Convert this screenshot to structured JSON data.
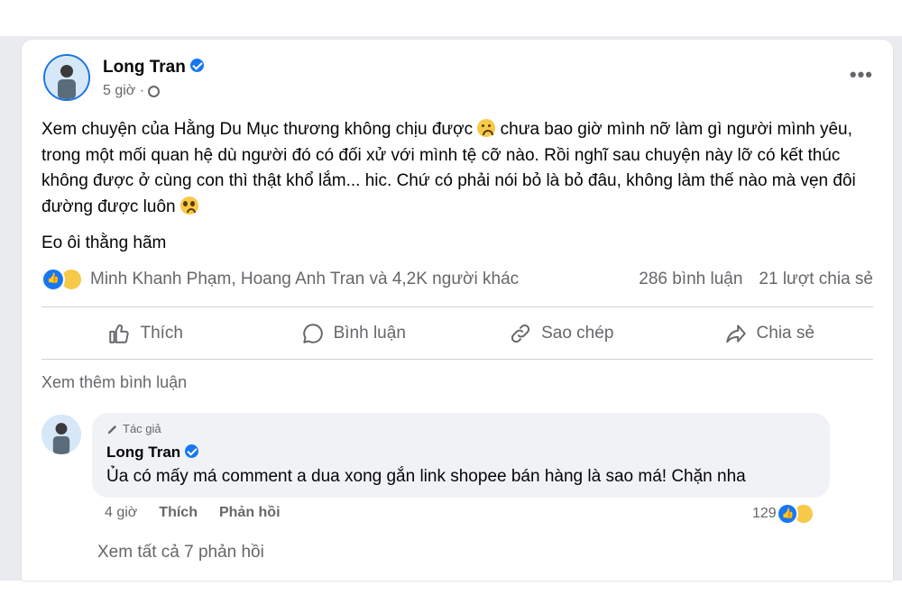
{
  "post": {
    "author": "Long Tran",
    "time": "5 giờ ·",
    "menu_label": "•••",
    "text_line1": "Xem chuyện của Hằng Du Mục thương không chịu được",
    "text_line1b": "chưa bao giờ mình nỡ làm gì người mình yêu, trong một mối quan hệ dù người đó có đối xử với mình tệ cỡ nào. Rồi nghĩ sau chuyện này lỡ có kết thúc không được ở cùng con thì thật khổ lắm... hic. Chứ có phải nói bỏ là bỏ đâu, không làm thế nào mà vẹn đôi đường được luôn",
    "text_para2": "Eo ôi thằng hãm",
    "reactions_summary": "Minh Khanh Phạm, Hoang Anh Tran và 4,2K người khác",
    "comments_count": "286 bình luận",
    "shares_count": "21 lượt chia sẻ"
  },
  "actions": {
    "like": "Thích",
    "comment": "Bình luận",
    "copy": "Sao chép",
    "share": "Chia sẻ"
  },
  "comments": {
    "see_more": "Xem thêm bình luận",
    "item": {
      "badge": "Tác giả",
      "author": "Long Tran",
      "text": "Ủa có mấy má comment a dua xong gắn link shopee bán hàng là sao má! Chặn nha",
      "time": "4 giờ",
      "like": "Thích",
      "reply": "Phản hồi",
      "reaction_count": "129"
    },
    "see_replies": "Xem tất cả 7 phản hồi"
  },
  "colors": {
    "accent": "#1877f2",
    "muted_text": "#65676b",
    "bubble_bg": "#f0f2f5"
  }
}
